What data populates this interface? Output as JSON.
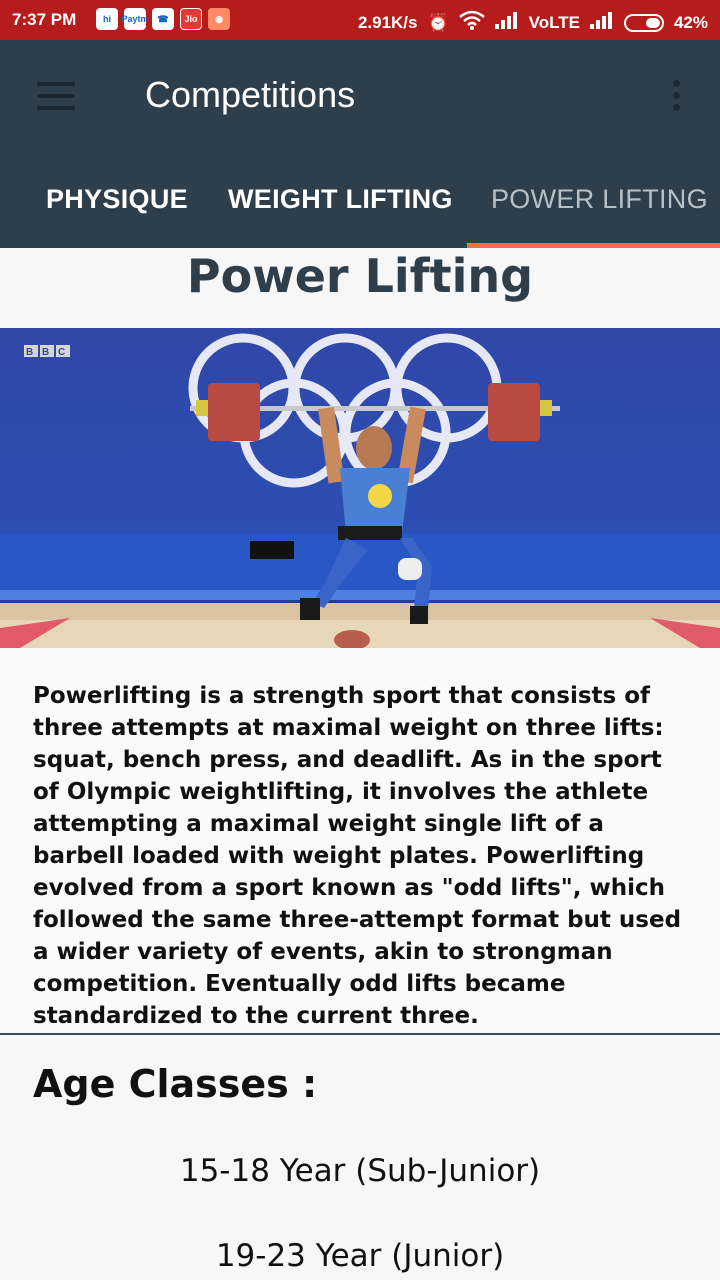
{
  "status_bar": {
    "time": "7:37 PM",
    "net_speed": "2.91K/s",
    "network": "VoLTE",
    "battery": "42%",
    "notif_icons": [
      "hike-icon",
      "paytm-icon",
      "phone-icon",
      "jio-icon",
      "cat-app-icon"
    ],
    "notif_labels": [
      "hi",
      "Paytm",
      "",
      "Jio",
      ""
    ]
  },
  "app_bar": {
    "title": "Competitions"
  },
  "tabs": [
    {
      "label": "PHYSIQUE"
    },
    {
      "label": "WEIGHT LIFTING"
    },
    {
      "label": "POWER LIFTING",
      "active": true
    }
  ],
  "content": {
    "heading": "Power Lifting",
    "image": {
      "logo_text": "BBC"
    },
    "description": "Powerlifting is a strength sport that consists of three attempts at maximal weight on three lifts: squat, bench press, and deadlift. As in the sport of Olympic weightlifting, it involves the athlete attempting a maximal weight single lift of a barbell loaded with weight plates. Powerlifting evolved from a sport known as \"odd lifts\", which followed the same three-attempt format but used a wider variety of events, akin to strongman competition. Eventually odd lifts became standardized to the current three.",
    "age_classes_title": "Age Classes :",
    "age_classes": [
      "15-18 Year (Sub-Junior)",
      "19-23 Year (Junior)"
    ]
  },
  "colors": {
    "status_bar": "#b71c1c",
    "app_bar": "#2e3f4b",
    "tab_indicator": "#ff6d3f"
  }
}
